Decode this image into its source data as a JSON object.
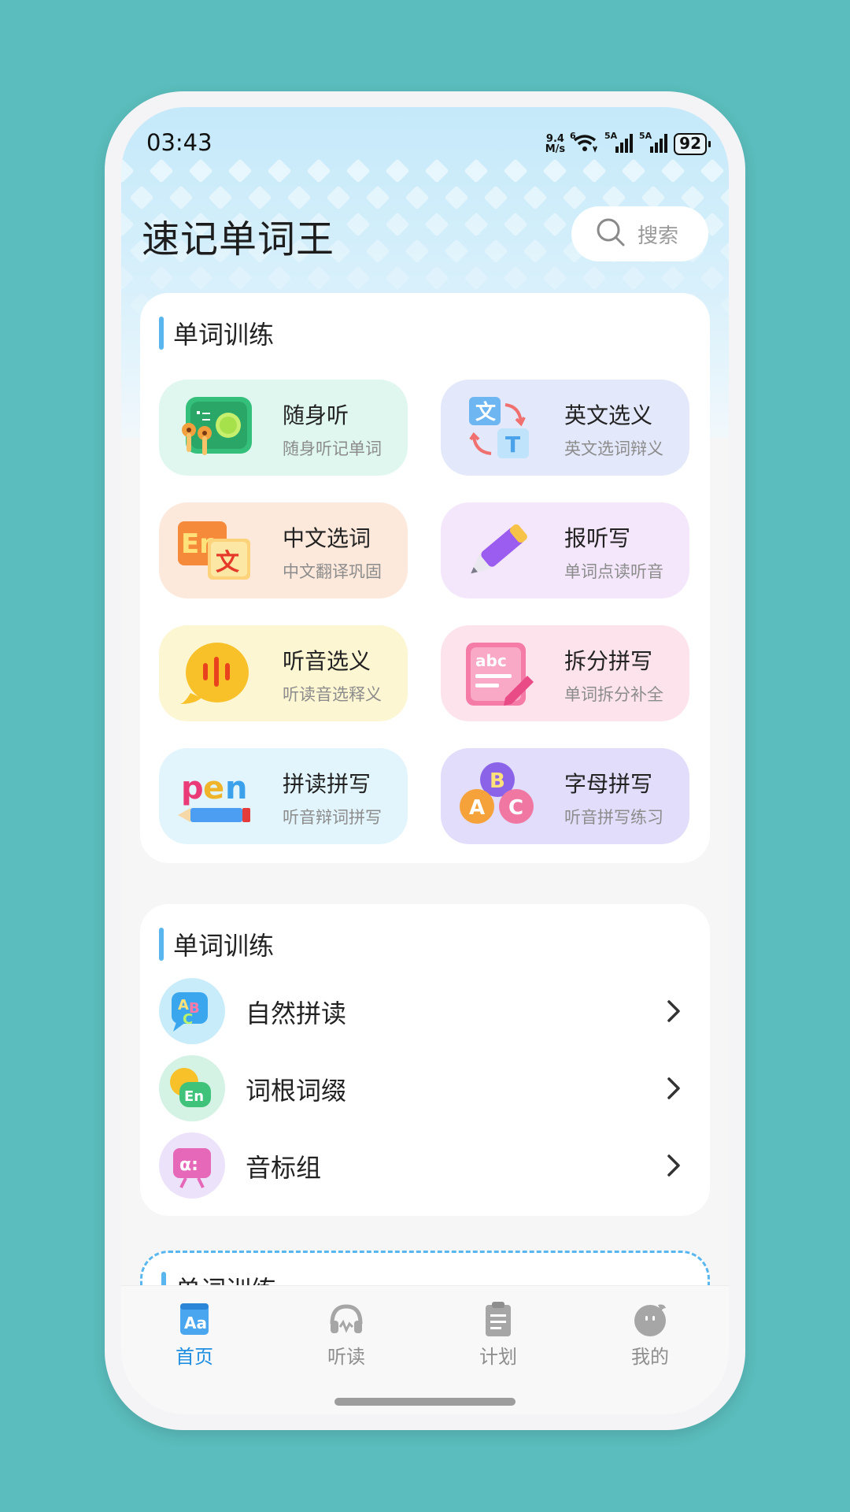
{
  "status_bar": {
    "time": "03:43",
    "net_speed_top": "9.4",
    "net_speed_bottom": "M/s",
    "wifi_label": "6",
    "sim1_label": "5A",
    "sim2_label": "5A",
    "battery": "92"
  },
  "header": {
    "title": "速记单词王",
    "search_label": "搜索"
  },
  "training": {
    "title": "单词训练",
    "tiles": [
      {
        "title": "随身听",
        "subtitle": "随身听记单词",
        "icon": "earbuds-board-icon",
        "bg": "#dff7ef"
      },
      {
        "title": "英文选义",
        "subtitle": "英文选词辩义",
        "icon": "translate-icon",
        "bg": "#e3e8fb"
      },
      {
        "title": "中文选词",
        "subtitle": "中文翻译巩固",
        "icon": "en-wen-icon",
        "bg": "#fde9dc"
      },
      {
        "title": "报听写",
        "subtitle": "单词点读听音",
        "icon": "pen-icon",
        "bg": "#f4e7fb"
      },
      {
        "title": "听音选义",
        "subtitle": "听读音选释义",
        "icon": "voice-bubble-icon",
        "bg": "#fdf6d2"
      },
      {
        "title": "拆分拼写",
        "subtitle": "单词拆分补全",
        "icon": "abc-card-icon",
        "bg": "#fde4ec"
      },
      {
        "title": "拼读拼写",
        "subtitle": "听音辩词拼写",
        "icon": "pen-word-icon",
        "bg": "#e2f5fc"
      },
      {
        "title": "字母拼写",
        "subtitle": "听音拼写练习",
        "icon": "abc-bubbles-icon",
        "bg": "#e2ddfb"
      }
    ]
  },
  "training2": {
    "title": "单词训练",
    "rows": [
      {
        "label": "自然拼读",
        "icon": "abc-chat-icon"
      },
      {
        "label": "词根词缀",
        "icon": "en-chat-icon"
      },
      {
        "label": "音标组",
        "icon": "phonetic-icon"
      }
    ]
  },
  "training3": {
    "title": "单词训练"
  },
  "nav": {
    "items": [
      {
        "label": "首页",
        "icon": "home-aa-icon",
        "active": true
      },
      {
        "label": "听读",
        "icon": "headphones-icon",
        "active": false
      },
      {
        "label": "计划",
        "icon": "clipboard-icon",
        "active": false
      },
      {
        "label": "我的",
        "icon": "profile-face-icon",
        "active": false
      }
    ]
  },
  "colors": {
    "accent": "#1f8ee0",
    "section_bar": "#5ab6ef",
    "background": "#5bbdbd"
  }
}
